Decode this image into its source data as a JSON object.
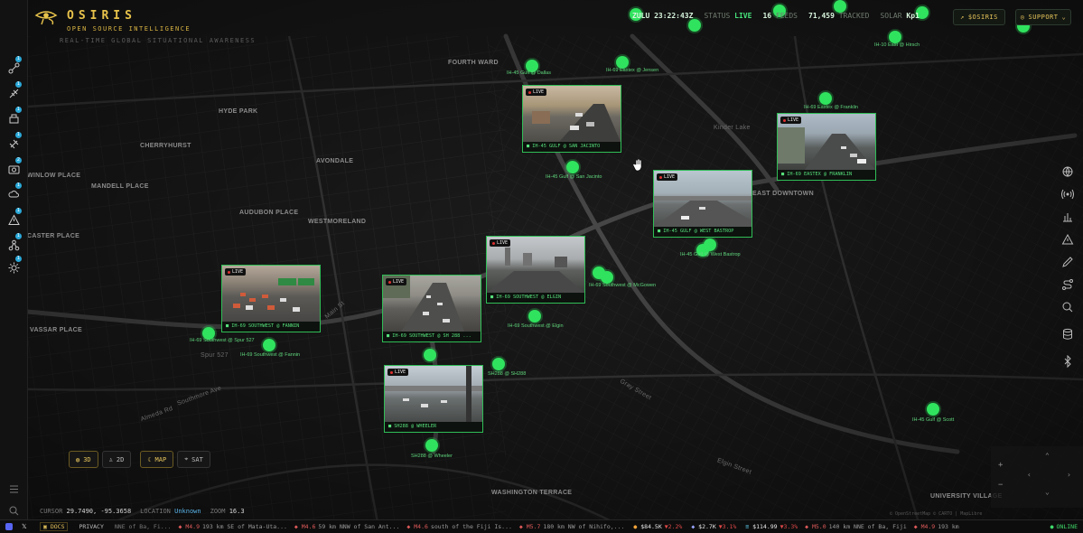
{
  "brand": {
    "name": "OSIRIS",
    "subtitle": "OPEN SOURCE INTELLIGENCE",
    "tagline": "REAL-TIME GLOBAL SITUATIONAL AWARENESS"
  },
  "status": {
    "clock": "ZULU 23:22:43Z",
    "status_label": "STATUS",
    "status_value": "LIVE",
    "feeds_value": "16",
    "feeds_label": "FEEDS",
    "tracks_value": "71,459",
    "tracks_label": "TRACKED",
    "solar_label": "SOLAR",
    "solar_value": "Kp1"
  },
  "header_buttons": {
    "token": "$OSIRIS",
    "support": "SUPPORT"
  },
  "sidebar": {
    "badges": [
      "1",
      "1",
      "1",
      "1",
      "2",
      "1",
      "1",
      "1",
      "1"
    ]
  },
  "map_labels": [
    "FOURTH WARD",
    "HYDE PARK",
    "CHERRYHURST",
    "AVONDALE",
    "WINLOW PLACE",
    "MANDELL PLACE",
    "AUDUBON PLACE",
    "WESTMORELAND",
    "CASTER PLACE",
    "VASSAR PLACE",
    "EAST DOWNTOWN",
    "Kinder Lake",
    "WASHINGTON TERRACE",
    "UNIVERSITY VILLAGE",
    "Elgin Street",
    "Gray Street",
    "Southmore Ave",
    "Almeda Rd",
    "Main St",
    "Spur 527"
  ],
  "cameras": [
    {
      "title": "IH-45 GULF @ SAN JACINTO",
      "live": "LIVE"
    },
    {
      "title": "IH-69 EASTEX @ FRANKLIN",
      "live": "LIVE"
    },
    {
      "title": "IH-45 GULF @ WEST BASTROP",
      "live": "LIVE"
    },
    {
      "title": "IH-69 SOUTHWEST @ ELGIN",
      "live": "LIVE"
    },
    {
      "title": "IH-69 SOUTHWEST @ FANNIN",
      "live": "LIVE"
    },
    {
      "title": "IH-69 SOUTHWEST @ SH 288 ...",
      "live": "LIVE"
    },
    {
      "title": "SH288 @ WHEELER",
      "live": "LIVE"
    }
  ],
  "pins": [
    "IH-45 Gulf @ San Jacinto",
    "IH-69 Eastex @ Franklin",
    "IH-45 Gulf @ West Bastrop",
    "IH-69 Southwest @ Elgin",
    "IH-69 Southwest @ Fannin",
    "IH-69 Southwest @ Spur 527",
    "SH288 @ Wheeler",
    "IH-45 Gulf @ Scott",
    "IH-69 Southwest @ McGowen",
    "SH288 @ SH288",
    "IH-45 Gulf @ Dallas",
    "IH-69 Eastex @ Jensen",
    "IH-10 East @ Hirsch",
    "IH-45 North @ Quitman",
    "IH-10 East @ US 59"
  ],
  "view_controls": [
    "3D",
    "2D",
    "MAP",
    "SAT"
  ],
  "coords": {
    "label": "CURSOR",
    "value": "29.7490, -95.3658",
    "loc_label": "LOCATION",
    "loc_value": "Unknown",
    "zoom_label": "ZOOM",
    "zoom_value": "16.3"
  },
  "footer_links": [
    "DOCS",
    "PRIVACY"
  ],
  "ticker": {
    "quakes": [
      {
        "mag": "M4.9",
        "text": "193 km SE of Mata-Uta..."
      },
      {
        "mag": "M4.6",
        "text": "59 km NNW of San Ant..."
      },
      {
        "mag": "M4.6",
        "text": "south of the Fiji Is..."
      },
      {
        "mag": "M5.7",
        "text": "180 km NW of Nihifo,..."
      }
    ],
    "lead": "NNE of Ba, Fi...",
    "markets": [
      {
        "price": "$84.5K",
        "change": "▼2.2%",
        "color": "#f2a33a"
      },
      {
        "price": "$2.7K",
        "change": "▼3.1%",
        "color": "#9aa6ff"
      },
      {
        "price": "$114.99",
        "change": "▼3.3%",
        "color": "#5ac8e8"
      }
    ],
    "tail": [
      {
        "mag": "M5.0",
        "text": "140 km NNE of Ba, Fiji"
      },
      {
        "mag": "M4.9",
        "text": "193 km"
      }
    ]
  },
  "online": "ONLINE",
  "attribution": "© OpenStreetMap © CARTO | MapLibre"
}
